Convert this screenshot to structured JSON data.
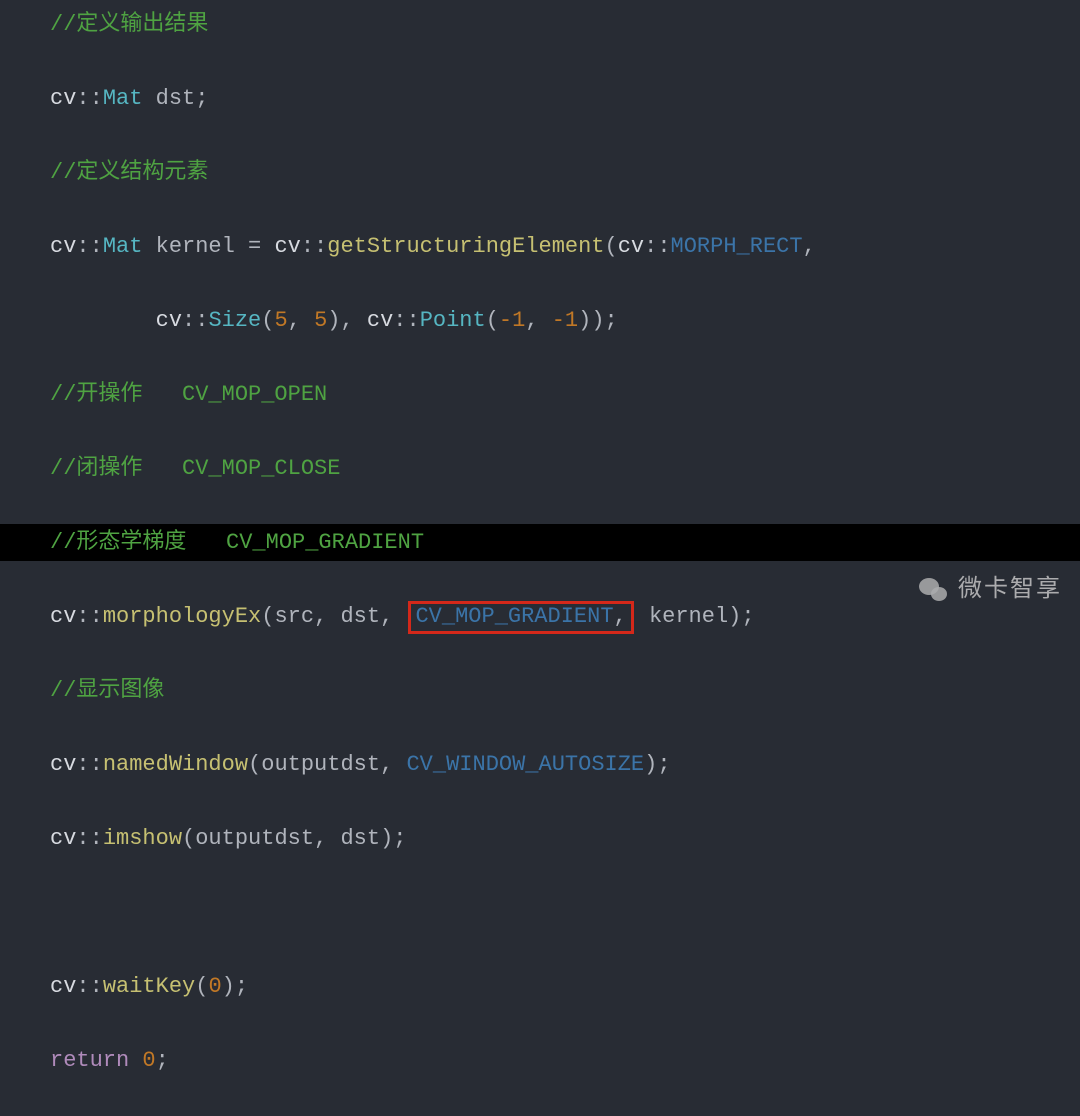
{
  "code": {
    "c1": "//定义输出结果",
    "l2_ns": "cv",
    "l2_ty": "Mat",
    "l2_id": "dst",
    "c3": "//定义结构元素",
    "l4_ns": "cv",
    "l4_ty": "Mat",
    "l4_id": "kernel",
    "l4_ns2": "cv",
    "l4_fn": "getStructuringElement",
    "l4_ns3": "cv",
    "l4_cn": "MORPH_RECT",
    "l5_ns": "cv",
    "l5_ty": "Size",
    "l5_a": "5",
    "l5_b": "5",
    "l5_ns2": "cv",
    "l5_ty2": "Point",
    "l5_c": "-1",
    "l5_d": "-1",
    "c6": "//开操作   CV_MOP_OPEN",
    "c7": "//闭操作   CV_MOP_CLOSE",
    "c8": "//形态学梯度   CV_MOP_GRADIENT",
    "l9_ns": "cv",
    "l9_fn": "morphologyEx",
    "l9_a": "src",
    "l9_b": "dst",
    "l9_box": "CV_MOP_GRADIENT",
    "l9_boxcomma": ",",
    "l9_c": "kernel",
    "c10": "//显示图像",
    "l11_ns": "cv",
    "l11_fn": "namedWindow",
    "l11_a": "outputdst",
    "l11_cn": "CV_WINDOW_AUTOSIZE",
    "l12_ns": "cv",
    "l12_fn": "imshow",
    "l12_a": "outputdst",
    "l12_b": "dst",
    "l14_ns": "cv",
    "l14_fn": "waitKey",
    "l14_a": "0",
    "l15_kw": "return",
    "l15_a": "0"
  },
  "watermark": "微卡智享"
}
